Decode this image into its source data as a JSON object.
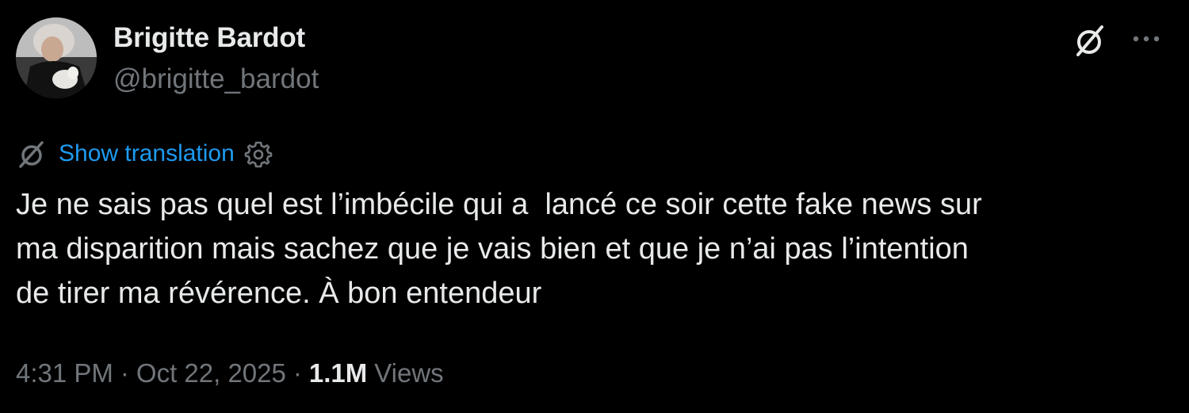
{
  "author": {
    "display_name": "Brigitte Bardot",
    "handle": "@brigitte_bardot",
    "avatar_icon": "profile-photo"
  },
  "header_actions": {
    "grok_icon": "grok-slash-icon",
    "more_icon": "ellipsis-icon"
  },
  "translation": {
    "label": "Show translation",
    "icon": "translate-slash-icon",
    "settings_icon": "gear-icon"
  },
  "tweet": {
    "lines": [
      "Je ne sais pas quel est l’imbécile qui a  lancé ce soir cette fake news sur",
      "ma disparition mais sachez que je vais bien et que je n’ai pas l’intention",
      "de tirer ma révérence. À bon entendeur"
    ]
  },
  "meta": {
    "time": "4:31 PM",
    "separator": "·",
    "date": "Oct 22, 2025",
    "views_count": "1.1M",
    "views_label": "Views"
  },
  "colors": {
    "background": "#000000",
    "text_primary": "#e7e9ea",
    "text_secondary": "#71767b",
    "link": "#1d9bf0"
  }
}
